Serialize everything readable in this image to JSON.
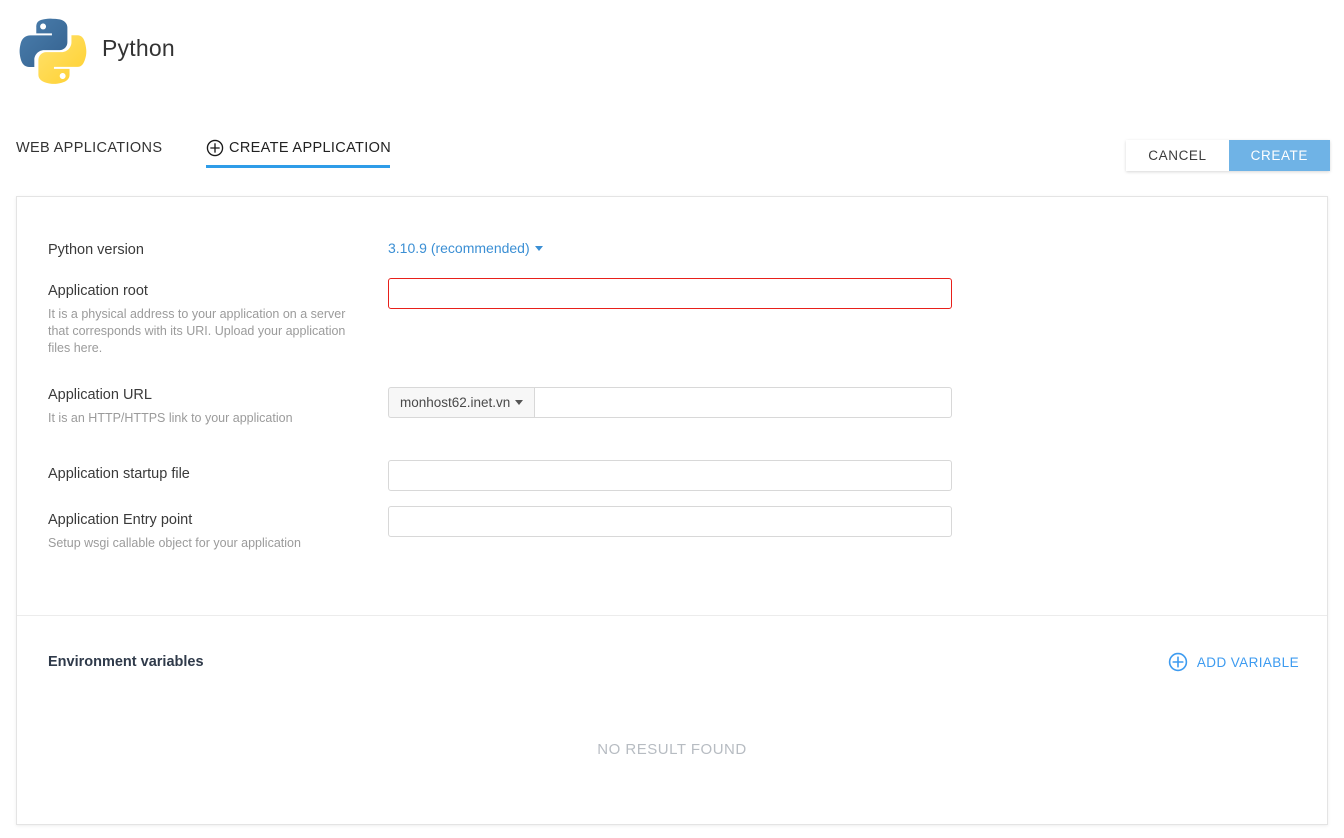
{
  "brand": {
    "title": "Python",
    "logo_icon": "python-logo-icon"
  },
  "tabs": [
    {
      "label": "WEB APPLICATIONS",
      "active": false,
      "icon": null
    },
    {
      "label": "CREATE APPLICATION",
      "active": true,
      "icon": "plus-circle-icon"
    }
  ],
  "toolbar": {
    "cancel_label": "CANCEL",
    "create_label": "CREATE"
  },
  "form": {
    "python_version": {
      "label": "Python version",
      "value": "3.10.9 (recommended)"
    },
    "application_root": {
      "label": "Application root",
      "hint": "It is a physical address to your application on a server that corresponds with its URI. Upload your application files here.",
      "value": "",
      "placeholder": "",
      "error": true
    },
    "application_url": {
      "label": "Application URL",
      "hint": "It is an HTTP/HTTPS link to your application",
      "domain": "monhost62.inet.vn",
      "value": "",
      "placeholder": ""
    },
    "application_startup_file": {
      "label": "Application startup file",
      "value": "",
      "placeholder": ""
    },
    "application_entry_point": {
      "label": "Application Entry point",
      "hint": "Setup wsgi callable object for your application",
      "value": "",
      "placeholder": ""
    }
  },
  "environment": {
    "title": "Environment variables",
    "add_label": "ADD VARIABLE",
    "add_icon": "plus-circle-icon",
    "empty_message": "NO RESULT FOUND"
  },
  "colors": {
    "accent_blue": "#2e9ce8",
    "button_blue": "#6fb3e6",
    "link_blue": "#3d9bf0",
    "error_red": "#e8201a",
    "python_blue": "#3c6e9f",
    "python_yellow": "#ffd845"
  }
}
